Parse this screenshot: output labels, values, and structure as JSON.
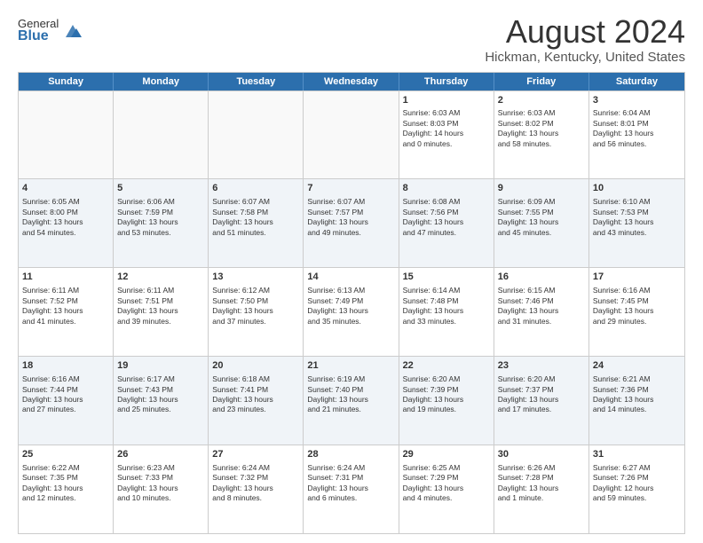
{
  "logo": {
    "general": "General",
    "blue": "Blue"
  },
  "title": "August 2024",
  "location": "Hickman, Kentucky, United States",
  "days_of_week": [
    "Sunday",
    "Monday",
    "Tuesday",
    "Wednesday",
    "Thursday",
    "Friday",
    "Saturday"
  ],
  "weeks": [
    [
      {
        "day": "",
        "content": "",
        "empty": true
      },
      {
        "day": "",
        "content": "",
        "empty": true
      },
      {
        "day": "",
        "content": "",
        "empty": true
      },
      {
        "day": "",
        "content": "",
        "empty": true
      },
      {
        "day": "1",
        "content": "Sunrise: 6:03 AM\nSunset: 8:03 PM\nDaylight: 14 hours\nand 0 minutes."
      },
      {
        "day": "2",
        "content": "Sunrise: 6:03 AM\nSunset: 8:02 PM\nDaylight: 13 hours\nand 58 minutes."
      },
      {
        "day": "3",
        "content": "Sunrise: 6:04 AM\nSunset: 8:01 PM\nDaylight: 13 hours\nand 56 minutes."
      }
    ],
    [
      {
        "day": "4",
        "content": "Sunrise: 6:05 AM\nSunset: 8:00 PM\nDaylight: 13 hours\nand 54 minutes."
      },
      {
        "day": "5",
        "content": "Sunrise: 6:06 AM\nSunset: 7:59 PM\nDaylight: 13 hours\nand 53 minutes."
      },
      {
        "day": "6",
        "content": "Sunrise: 6:07 AM\nSunset: 7:58 PM\nDaylight: 13 hours\nand 51 minutes."
      },
      {
        "day": "7",
        "content": "Sunrise: 6:07 AM\nSunset: 7:57 PM\nDaylight: 13 hours\nand 49 minutes."
      },
      {
        "day": "8",
        "content": "Sunrise: 6:08 AM\nSunset: 7:56 PM\nDaylight: 13 hours\nand 47 minutes."
      },
      {
        "day": "9",
        "content": "Sunrise: 6:09 AM\nSunset: 7:55 PM\nDaylight: 13 hours\nand 45 minutes."
      },
      {
        "day": "10",
        "content": "Sunrise: 6:10 AM\nSunset: 7:53 PM\nDaylight: 13 hours\nand 43 minutes."
      }
    ],
    [
      {
        "day": "11",
        "content": "Sunrise: 6:11 AM\nSunset: 7:52 PM\nDaylight: 13 hours\nand 41 minutes."
      },
      {
        "day": "12",
        "content": "Sunrise: 6:11 AM\nSunset: 7:51 PM\nDaylight: 13 hours\nand 39 minutes."
      },
      {
        "day": "13",
        "content": "Sunrise: 6:12 AM\nSunset: 7:50 PM\nDaylight: 13 hours\nand 37 minutes."
      },
      {
        "day": "14",
        "content": "Sunrise: 6:13 AM\nSunset: 7:49 PM\nDaylight: 13 hours\nand 35 minutes."
      },
      {
        "day": "15",
        "content": "Sunrise: 6:14 AM\nSunset: 7:48 PM\nDaylight: 13 hours\nand 33 minutes."
      },
      {
        "day": "16",
        "content": "Sunrise: 6:15 AM\nSunset: 7:46 PM\nDaylight: 13 hours\nand 31 minutes."
      },
      {
        "day": "17",
        "content": "Sunrise: 6:16 AM\nSunset: 7:45 PM\nDaylight: 13 hours\nand 29 minutes."
      }
    ],
    [
      {
        "day": "18",
        "content": "Sunrise: 6:16 AM\nSunset: 7:44 PM\nDaylight: 13 hours\nand 27 minutes."
      },
      {
        "day": "19",
        "content": "Sunrise: 6:17 AM\nSunset: 7:43 PM\nDaylight: 13 hours\nand 25 minutes."
      },
      {
        "day": "20",
        "content": "Sunrise: 6:18 AM\nSunset: 7:41 PM\nDaylight: 13 hours\nand 23 minutes."
      },
      {
        "day": "21",
        "content": "Sunrise: 6:19 AM\nSunset: 7:40 PM\nDaylight: 13 hours\nand 21 minutes."
      },
      {
        "day": "22",
        "content": "Sunrise: 6:20 AM\nSunset: 7:39 PM\nDaylight: 13 hours\nand 19 minutes."
      },
      {
        "day": "23",
        "content": "Sunrise: 6:20 AM\nSunset: 7:37 PM\nDaylight: 13 hours\nand 17 minutes."
      },
      {
        "day": "24",
        "content": "Sunrise: 6:21 AM\nSunset: 7:36 PM\nDaylight: 13 hours\nand 14 minutes."
      }
    ],
    [
      {
        "day": "25",
        "content": "Sunrise: 6:22 AM\nSunset: 7:35 PM\nDaylight: 13 hours\nand 12 minutes."
      },
      {
        "day": "26",
        "content": "Sunrise: 6:23 AM\nSunset: 7:33 PM\nDaylight: 13 hours\nand 10 minutes."
      },
      {
        "day": "27",
        "content": "Sunrise: 6:24 AM\nSunset: 7:32 PM\nDaylight: 13 hours\nand 8 minutes."
      },
      {
        "day": "28",
        "content": "Sunrise: 6:24 AM\nSunset: 7:31 PM\nDaylight: 13 hours\nand 6 minutes."
      },
      {
        "day": "29",
        "content": "Sunrise: 6:25 AM\nSunset: 7:29 PM\nDaylight: 13 hours\nand 4 minutes."
      },
      {
        "day": "30",
        "content": "Sunrise: 6:26 AM\nSunset: 7:28 PM\nDaylight: 13 hours\nand 1 minute."
      },
      {
        "day": "31",
        "content": "Sunrise: 6:27 AM\nSunset: 7:26 PM\nDaylight: 12 hours\nand 59 minutes."
      }
    ]
  ]
}
